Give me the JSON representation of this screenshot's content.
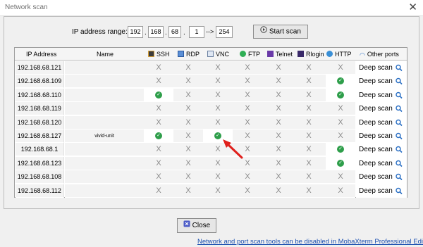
{
  "window": {
    "title": "Network scan",
    "close_glyph": "✕"
  },
  "range": {
    "label": "IP address range:",
    "octets": [
      "192",
      "168",
      "68",
      "1"
    ],
    "arrow": "-->",
    "end": "254"
  },
  "buttons": {
    "start_scan": "Start scan",
    "close": "Close"
  },
  "table": {
    "columns": {
      "ip": "IP Address",
      "name": "Name",
      "ssh": "SSH",
      "rdp": "RDP",
      "vnc": "VNC",
      "ftp": "FTP",
      "telnet": "Telnet",
      "rlogin": "Rlogin",
      "http": "HTTP",
      "other": "Other ports"
    },
    "deep_scan_label": "Deep scan",
    "unavailable_glyph": "X",
    "available_glyph": "✓",
    "rows": [
      {
        "ip": "192.168.68.121",
        "name": "",
        "ports": [
          0,
          0,
          0,
          0,
          0,
          0,
          0
        ]
      },
      {
        "ip": "192.168.68.109",
        "name": "",
        "ports": [
          0,
          0,
          0,
          0,
          0,
          0,
          1
        ]
      },
      {
        "ip": "192.168.68.110",
        "name": "",
        "ports": [
          1,
          0,
          0,
          0,
          0,
          0,
          1
        ]
      },
      {
        "ip": "192.168.68.119",
        "name": "",
        "ports": [
          0,
          0,
          0,
          0,
          0,
          0,
          0
        ]
      },
      {
        "ip": "192.168.68.120",
        "name": "",
        "ports": [
          0,
          0,
          0,
          0,
          0,
          0,
          0
        ]
      },
      {
        "ip": "192.168.68.127",
        "name": "vivid-unit",
        "ports": [
          1,
          0,
          1,
          0,
          0,
          0,
          0
        ]
      },
      {
        "ip": "192.168.68.1",
        "name": "",
        "ports": [
          0,
          0,
          0,
          0,
          0,
          0,
          1
        ]
      },
      {
        "ip": "192.168.68.123",
        "name": "",
        "ports": [
          0,
          0,
          0,
          0,
          0,
          0,
          1
        ]
      },
      {
        "ip": "192.168.68.108",
        "name": "",
        "ports": [
          0,
          0,
          0,
          0,
          0,
          0,
          0
        ]
      },
      {
        "ip": "192.168.68.112",
        "name": "",
        "ports": [
          0,
          0,
          0,
          0,
          0,
          0,
          0
        ]
      }
    ]
  },
  "footer": {
    "link": "Network and port scan tools can be disabled in MobaXterm Professional Edition"
  },
  "colors": {
    "check": "#2e9e4a",
    "annotation_arrow": "#e0201c",
    "link": "#1a4fb0"
  }
}
